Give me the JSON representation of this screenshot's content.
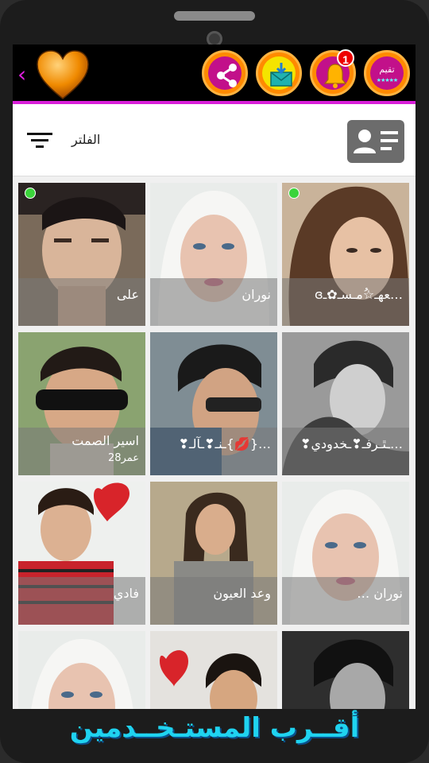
{
  "topbar": {
    "back_icon": "chevron-left-icon",
    "heart_icon": "heart-icon",
    "share_icon": "share-icon",
    "mail_icon": "mail-download-icon",
    "bell_icon": "bell-icon",
    "notification_count": "1",
    "rate_label": "تقيم",
    "rate_stars": "★★★★★",
    "accent": "#d81fd8",
    "button_color": "#ff8a00"
  },
  "filter": {
    "label": "الفلتر",
    "filter_icon": "filter-lines-icon",
    "profile_icon": "id-card-icon"
  },
  "users": [
    {
      "name": "على",
      "age": "",
      "online": true
    },
    {
      "name": "نوران",
      "age": "",
      "online": false
    },
    {
      "name": "…ﻌﻬـ☆ُمـسـ✿ـɞ",
      "age": "",
      "online": true
    },
    {
      "name": "اسير الصمت",
      "age": "28عمر",
      "online": false
    },
    {
      "name": "…{💋}ـنـ❣ـآلـ❣",
      "age": "",
      "online": false
    },
    {
      "name": "…ـﭥـرفـ❣ـخدودي❣",
      "age": "",
      "online": false
    },
    {
      "name": "فادي",
      "age": "",
      "online": false
    },
    {
      "name": "وعد العيون",
      "age": "",
      "online": false
    },
    {
      "name": "نوران …",
      "age": "",
      "online": false
    },
    {
      "name": "",
      "age": "",
      "online": false
    },
    {
      "name": "",
      "age": "",
      "online": false
    },
    {
      "name": "",
      "age": "",
      "online": false
    }
  ],
  "footer": {
    "title": "أقــرب المستـخــدمين"
  }
}
